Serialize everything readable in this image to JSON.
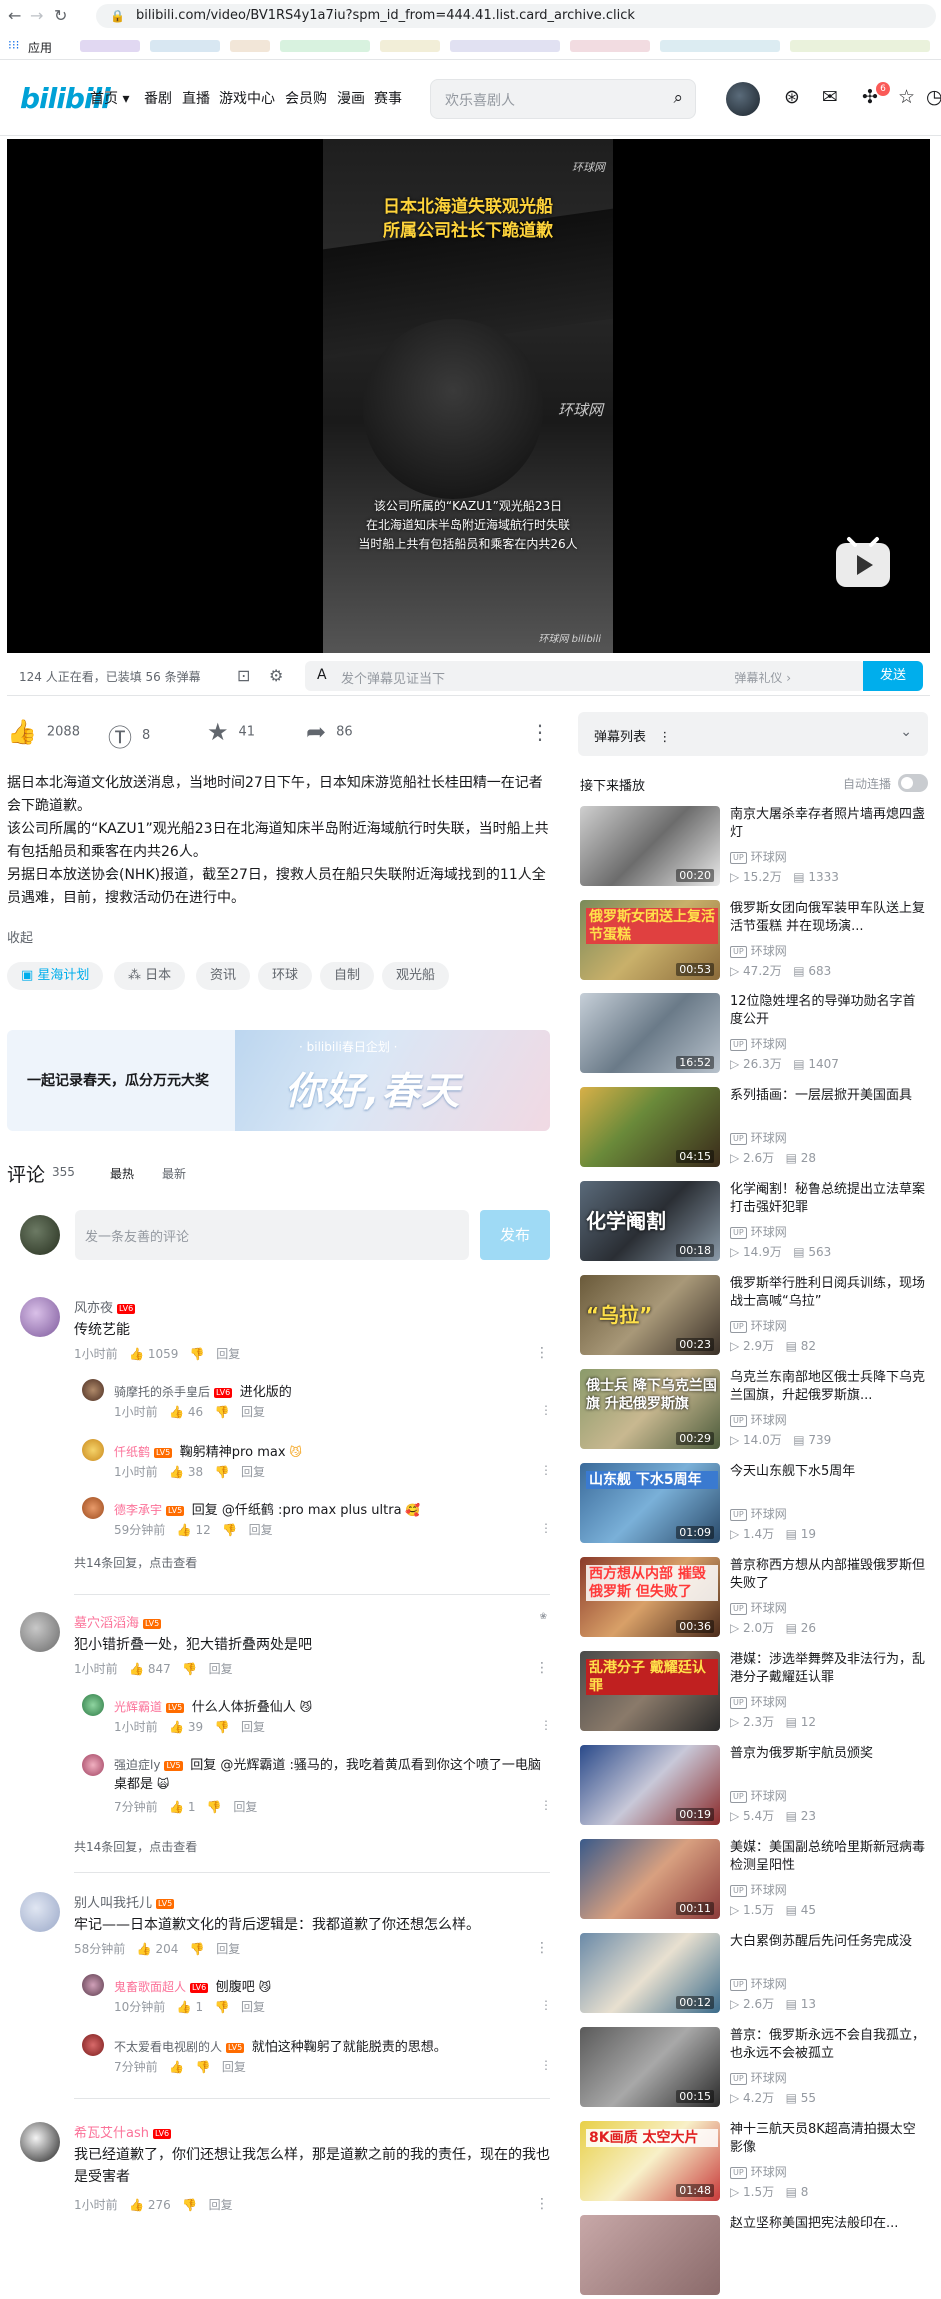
{
  "browser": {
    "url": "bilibili.com/video/BV1RS4y1a7iu?spm_id_from=444.41.list.card_archive.click",
    "apps_label": "应用"
  },
  "header": {
    "logo": "bilibili",
    "nav": [
      "首页",
      "番剧",
      "直播",
      "游戏中心",
      "会员购",
      "漫画",
      "赛事"
    ],
    "search_placeholder": "欢乐喜剧人",
    "notification_count": "6"
  },
  "player": {
    "title_line1": "日本北海道失联观光船",
    "title_line2": "所属公司社长下跪道歉",
    "watermark": "环球网",
    "subtitle_line1": "该公司所属的“KAZU1”观光船23日",
    "subtitle_line2": "在北海道知床半岛附近海域航行时失联",
    "subtitle_line3": "当时船上共有包括船员和乘客在内共26人",
    "bottom_mark": "环球网 bilibili"
  },
  "danmaku_bar": {
    "info": "124 人正在看，已装填 56 条弹幕",
    "input_placeholder": "发个弹幕见证当下",
    "etiquette": "弹幕礼仪 ›",
    "send": "发送"
  },
  "toolbar": {
    "like": "2088",
    "coin": "8",
    "favorite": "41",
    "share": "86"
  },
  "description": {
    "line1": "据日本北海道文化放送消息，当地时间27日下午，日本知床游览船社长桂田精一在记者会下跪道歉。",
    "line2": "该公司所属的“KAZU1”观光船23日在北海道知床半岛附近海域航行时失联，当时船上共有包括船员和乘客在内共26人。",
    "line3": "另据日本放送协会(NHK)报道，截至27日，搜救人员在船只失联附近海域找到的11人全员遇难，目前，搜救活动仍在进行中。",
    "collapse": "收起"
  },
  "tags": [
    "星海计划",
    "日本",
    "资讯",
    "环球",
    "自制",
    "观光船"
  ],
  "banner": {
    "left": "一起记录春天，瓜分万元大奖",
    "right_small": "· bilibili春日企划 ·",
    "right_big": "你好,春天"
  },
  "comments": {
    "title": "评论",
    "count": "355",
    "sort_hot": "最热",
    "sort_new": "最新",
    "input_placeholder": "发一条友善的评论",
    "publish": "发布",
    "reply_label": "回复",
    "items": [
      {
        "user": "风亦夜",
        "level": "LV6",
        "text": "传统艺能",
        "time": "1小时前",
        "likes": "1059",
        "replies": [
          {
            "user": "骑摩托的杀手皇后",
            "level": "LV6",
            "text": "进化版的",
            "time": "1小时前",
            "likes": "46"
          },
          {
            "user": "仟纸鹤",
            "level": "LV5",
            "text": "鞠躬精神pro max",
            "time": "1小时前",
            "likes": "38"
          },
          {
            "user": "德李承宇",
            "level": "LV5",
            "text": "回复 @仟纸鹤 :pro max plus ultra",
            "time": "59分钟前",
            "likes": "12"
          }
        ],
        "more": "共14条回复，点击查看"
      },
      {
        "user": "墓穴滔滔海",
        "level": "LV5",
        "text": "犯小错折叠一处，犯大错折叠两处是吧",
        "time": "1小时前",
        "likes": "847",
        "replies": [
          {
            "user": "光辉霸道",
            "level": "LV5",
            "text": "什么人体折叠仙人",
            "time": "1小时前",
            "likes": "39"
          },
          {
            "user": "强迫症ly",
            "level": "LV5",
            "text": "回复 @光辉霸道 :骚马的，我吃着黄瓜看到你这个喷了一电脑桌都是",
            "time": "7分钟前",
            "likes": "1"
          }
        ],
        "more": "共14条回复，点击查看"
      },
      {
        "user": "别人叫我托儿",
        "level": "LV5",
        "text": "牢记——日本道歉文化的背后逻辑是：我都道歉了你还想怎么样。",
        "time": "58分钟前",
        "likes": "204",
        "replies": [
          {
            "user": "鬼畜歌面超人",
            "level": "LV6",
            "text": "刨腹吧",
            "time": "10分钟前",
            "likes": "1"
          },
          {
            "user": "不太爱看电视剧的人",
            "level": "LV5",
            "text": "就怕这种鞠躬了就能脱责的思想。",
            "time": "7分钟前",
            "likes": ""
          }
        ],
        "more": ""
      },
      {
        "user": "希瓦艾什ash",
        "level": "LV6",
        "text": "我已经道歉了，你们还想让我怎么样，那是道歉之前的我的责任，现在的我也是受害者",
        "time": "1小时前",
        "likes": "276",
        "replies": [],
        "more": ""
      }
    ]
  },
  "sidebar": {
    "danmaku_list": "弹幕列表",
    "next_title": "接下来播放",
    "autoplay": "自动连播",
    "up_label": "UP",
    "recommendations": [
      {
        "title": "南京大屠杀幸存者照片墙再熄四盏灯",
        "up": "环球网",
        "views": "15.2万",
        "danmaku": "1333",
        "duration": "00:20",
        "cap": ""
      },
      {
        "title": "俄罗斯女团向俄军装甲车队送上复活节蛋糕 并在现场演...",
        "up": "环球网",
        "views": "47.2万",
        "danmaku": "683",
        "duration": "00:53",
        "cap": "俄罗斯女团送上复活节蛋糕"
      },
      {
        "title": "12位隐姓埋名的导弹功勋名字首度公开",
        "up": "环球网",
        "views": "26.3万",
        "danmaku": "1407",
        "duration": "16:52",
        "cap": ""
      },
      {
        "title": "系列插画：一层层掀开美国面具",
        "up": "环球网",
        "views": "2.6万",
        "danmaku": "28",
        "duration": "04:15",
        "cap": ""
      },
      {
        "title": "化学阉割！秘鲁总统提出立法草案打击强奸犯罪",
        "up": "环球网",
        "views": "14.9万",
        "danmaku": "563",
        "duration": "00:18",
        "cap": "化学阉割"
      },
      {
        "title": "俄罗斯举行胜利日阅兵训练，现场战士高喊“乌拉”",
        "up": "环球网",
        "views": "2.9万",
        "danmaku": "82",
        "duration": "00:23",
        "cap": "“乌拉”"
      },
      {
        "title": "乌克兰东南部地区俄士兵降下乌克兰国旗，升起俄罗斯旗...",
        "up": "环球网",
        "views": "14.0万",
        "danmaku": "739",
        "duration": "00:29",
        "cap": "俄士兵 降下乌克兰国旗 升起俄罗斯旗"
      },
      {
        "title": "今天山东舰下水5周年",
        "up": "环球网",
        "views": "1.4万",
        "danmaku": "19",
        "duration": "01:09",
        "cap": "山东舰 下水5周年"
      },
      {
        "title": "普京称西方想从内部摧毁俄罗斯但失败了",
        "up": "环球网",
        "views": "2.0万",
        "danmaku": "26",
        "duration": "00:36",
        "cap": "西方想从内部 摧毁俄罗斯 但失败了"
      },
      {
        "title": "港媒：涉选举舞弊及非法行为，乱港分子戴耀廷认罪",
        "up": "环球网",
        "views": "2.3万",
        "danmaku": "12",
        "duration": "",
        "cap": "乱港分子 戴耀廷认罪"
      },
      {
        "title": "普京为俄罗斯宇航员颁奖",
        "up": "环球网",
        "views": "5.4万",
        "danmaku": "23",
        "duration": "00:19",
        "cap": ""
      },
      {
        "title": "美媒：美国副总统哈里斯新冠病毒检测呈阳性",
        "up": "环球网",
        "views": "1.5万",
        "danmaku": "45",
        "duration": "00:11",
        "cap": ""
      },
      {
        "title": "大白累倒苏醒后先问任务完成没",
        "up": "环球网",
        "views": "2.6万",
        "danmaku": "13",
        "duration": "00:12",
        "cap": ""
      },
      {
        "title": "普京：俄罗斯永远不会自我孤立，也永远不会被孤立",
        "up": "环球网",
        "views": "4.2万",
        "danmaku": "55",
        "duration": "00:15",
        "cap": ""
      },
      {
        "title": "神十三航天员8K超高清拍摄太空影像",
        "up": "环球网",
        "views": "1.5万",
        "danmaku": "8",
        "duration": "01:48",
        "cap": "8K画质 太空大片"
      },
      {
        "title": "赵立坚称美国把宪法般印在...",
        "up": "",
        "views": "",
        "danmaku": "",
        "duration": "",
        "cap": ""
      }
    ]
  },
  "colors": {
    "brand": "#00aeec",
    "level6": "#ff0000",
    "level5": "#ff6c00",
    "vip_name": "#fb7299"
  }
}
